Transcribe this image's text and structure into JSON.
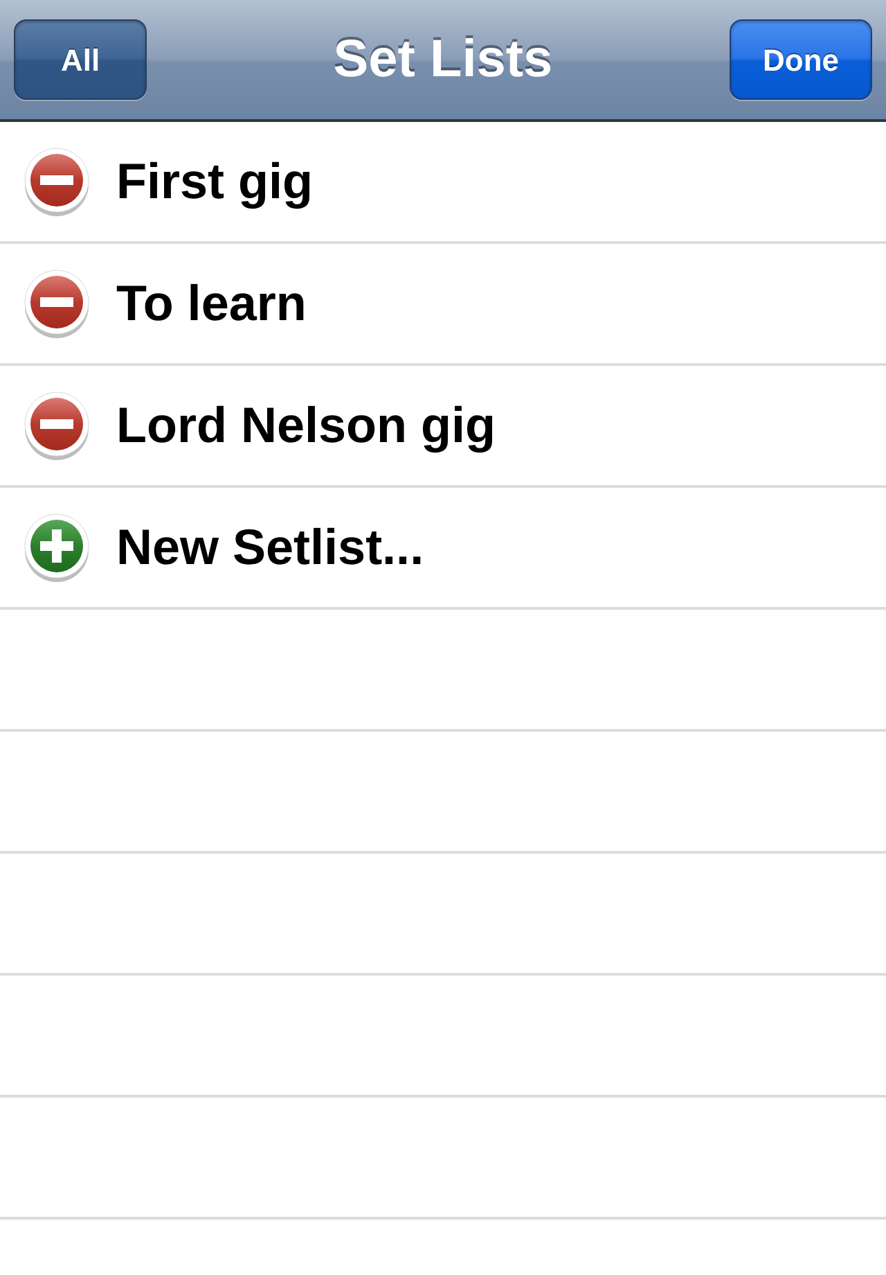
{
  "nav_bar": {
    "title": "Set Lists",
    "buttons": [
      {
        "label": "All",
        "kind": "plain"
      },
      {
        "label": "Done",
        "kind": "done"
      }
    ]
  },
  "rows": [
    {
      "kind": "delete",
      "label": "First gig"
    },
    {
      "kind": "delete",
      "label": "To learn"
    },
    {
      "kind": "delete",
      "label": "Lord Nelson gig"
    },
    {
      "kind": "insert",
      "label": "New Setlist..."
    }
  ]
}
